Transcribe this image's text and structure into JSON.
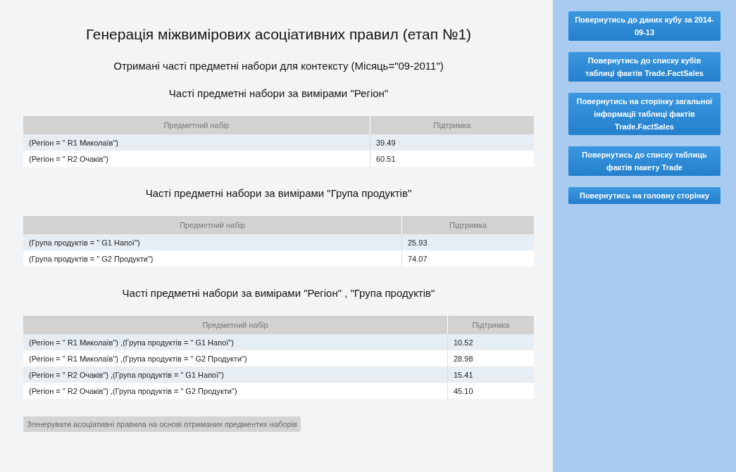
{
  "title": "Генерація міжвимірових асоціативних правил (етап №1)",
  "subtitle": "Отримані часті предметні набори для контексту (Місяць=\"09-2011\")",
  "sections": [
    {
      "heading": "Часті предметні набори за вимірами \"Регіон\"",
      "columns": [
        "Предметний набір",
        "Підтримка"
      ],
      "rows": [
        [
          "(Регіон = \" R1 Миколаїв\")",
          "39.49"
        ],
        [
          "(Регіон = \" R2 Очаків\")",
          "60.51"
        ]
      ]
    },
    {
      "heading": "Часті предметні набори за вимірами \"Група продуктів\"",
      "columns": [
        "Предметний набір",
        "Підтримка"
      ],
      "rows": [
        [
          "(Група продуктів = \" G1 Напої\")",
          "25.93"
        ],
        [
          "(Група продуктів = \" G2 Продукти\")",
          "74.07"
        ]
      ]
    },
    {
      "heading": "Часті предметні набори за вимірами \"Регіон\" , \"Група продуктів\"",
      "columns": [
        "Предметний набір",
        "Підтримка"
      ],
      "rows": [
        [
          "(Регіон = \" R1 Миколаїв\") ,(Група продуктів = \" G1 Напої\")",
          "10.52"
        ],
        [
          "(Регіон = \" R1 Миколаїв\") ,(Група продуктів = \" G2 Продукти\")",
          "28.98"
        ],
        [
          "(Регіон = \" R2 Очаків\") ,(Група продуктів = \" G1 Напої\")",
          "15.41"
        ],
        [
          "(Регіон = \" R2 Очаків\") ,(Група продуктів = \" G2 Продукти\")",
          "45.10"
        ]
      ]
    }
  ],
  "generate_button": "Згенерувати асоціативні правила на основі отриманих предментих наборів",
  "sidebar_buttons": [
    "Повернутись до даних кубу за 2014-09-13",
    "Повернутись до списку кубів таблиці фактів Trade.FactSales",
    "Повернутись на сторінку загальної інформації таблиці фактів Trade.FactSales",
    "Повернутись до списку таблиць фактів пакету Trade",
    "Повернутись на головну сторінку"
  ]
}
